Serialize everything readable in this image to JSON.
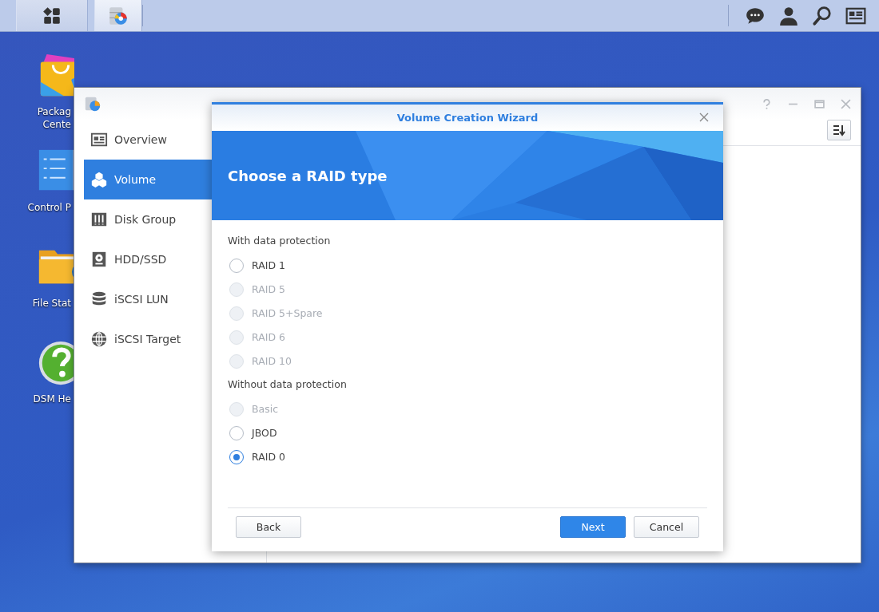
{
  "taskbar": {
    "left_buttons": [
      {
        "kind": "main-menu",
        "selected": false
      },
      {
        "kind": "app",
        "selected": true
      }
    ],
    "right_icons": [
      {
        "kind": "chat"
      },
      {
        "kind": "user"
      },
      {
        "kind": "search"
      },
      {
        "kind": "widgets"
      }
    ]
  },
  "desktop": {
    "icons": [
      {
        "kind": "package",
        "label": "Packag\nCente"
      },
      {
        "kind": "control",
        "label": "Control P"
      },
      {
        "kind": "folder",
        "label": "File Stat"
      },
      {
        "kind": "help",
        "label": "DSM He"
      }
    ]
  },
  "window": {
    "sidebar": {
      "items": [
        {
          "label": "Overview",
          "selected": false
        },
        {
          "label": "Volume",
          "selected": true
        },
        {
          "label": "Disk Group",
          "selected": false
        },
        {
          "label": "HDD/SSD",
          "selected": false
        },
        {
          "label": "iSCSI LUN",
          "selected": false
        },
        {
          "label": "iSCSI Target",
          "selected": false
        }
      ]
    }
  },
  "wizard": {
    "title": "Volume Creation Wizard",
    "heading": "Choose a RAID type",
    "groups": [
      {
        "label": "With data protection",
        "options": [
          {
            "label": "RAID 1",
            "selected": false,
            "disabled": false
          },
          {
            "label": "RAID 5",
            "selected": false,
            "disabled": true
          },
          {
            "label": "RAID 5+Spare",
            "selected": false,
            "disabled": true
          },
          {
            "label": "RAID 6",
            "selected": false,
            "disabled": true
          },
          {
            "label": "RAID 10",
            "selected": false,
            "disabled": true
          }
        ]
      },
      {
        "label": "Without data protection",
        "options": [
          {
            "label": "Basic",
            "selected": false,
            "disabled": true
          },
          {
            "label": "JBOD",
            "selected": false,
            "disabled": false
          },
          {
            "label": "RAID 0",
            "selected": true,
            "disabled": false
          }
        ]
      }
    ],
    "footer": {
      "left": [
        {
          "label": "Back",
          "kind": "secondary"
        }
      ],
      "right": [
        {
          "label": "Next",
          "kind": "primary"
        },
        {
          "label": "Cancel",
          "kind": "secondary"
        }
      ]
    }
  }
}
